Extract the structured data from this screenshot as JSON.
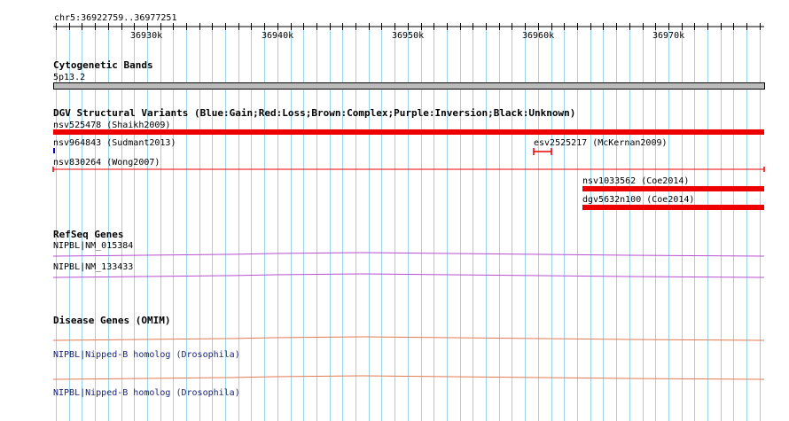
{
  "ruler": {
    "range_label": "chr5:36922759..36977251",
    "ticks": [
      "36930k",
      "36940k",
      "36950k",
      "36960k",
      "36970k"
    ]
  },
  "tracks": {
    "cytoband": {
      "title": "Cytogenetic Bands",
      "band_label": "5p13.2"
    },
    "dgv": {
      "title": "DGV Structural Variants (Blue:Gain;Red:Loss;Brown:Complex;Purple:Inversion;Black:Unknown)",
      "variants": [
        {
          "label": "nsv525478 (Shaikh2009)",
          "type": "Loss"
        },
        {
          "label": "nsv964843 (Sudmant2013)",
          "type": "Gain"
        },
        {
          "label": "esv2525217 (McKernan2009)",
          "type": "Loss"
        },
        {
          "label": "nsv830264 (Wong2007)",
          "type": "Loss"
        },
        {
          "label": "nsv1033562 (Coe2014)",
          "type": "Loss"
        },
        {
          "label": "dgv5632n100 (Coe2014)",
          "type": "Loss"
        }
      ]
    },
    "refseq": {
      "title": "RefSeq Genes",
      "genes": [
        {
          "label": "NIPBL|NM_015384"
        },
        {
          "label": "NIPBL|NM_133433"
        }
      ]
    },
    "omim": {
      "title": "Disease Genes (OMIM)",
      "genes": [
        {
          "label": "NIPBL|Nipped-B homolog (Drosophila)"
        },
        {
          "label": "NIPBL|Nipped-B homolog (Drosophila)"
        }
      ]
    }
  },
  "colors": {
    "grid_line": "#9dd3e6",
    "gain": "#0000cc",
    "loss": "#ee0000",
    "refseq_gene": "#b94fd0",
    "omim_gene": "#e07a52",
    "omim_label": "#1a237e",
    "cytoband_fill": "#bbbbbb"
  }
}
